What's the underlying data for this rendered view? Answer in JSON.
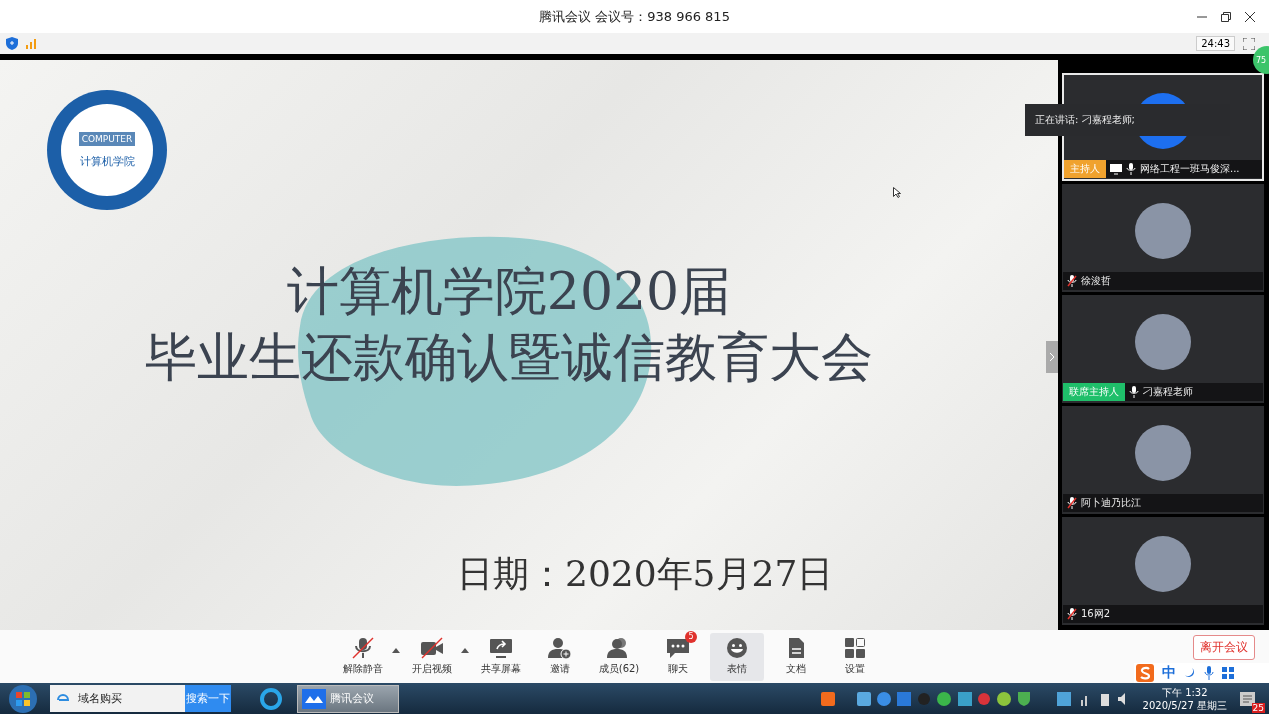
{
  "window": {
    "title": "腾讯会议 会议号：938 966 815"
  },
  "top_bar": {
    "timer": "24:43",
    "network_badge": "75"
  },
  "slide": {
    "logo_text": "COMPUTER",
    "logo_caption": "计算机学院",
    "title_lines": [
      "计算机学院2020届",
      "毕业生还款确认暨诚信教育大会"
    ],
    "date": "日期：2020年5月27日"
  },
  "speaking_tooltip": "正在讲话: 刁嘉程老师;",
  "participants": [
    {
      "name": "网络工程一班马俊深...",
      "role": "主持人",
      "color": "#f0a22e",
      "muted": false,
      "sharing": true,
      "selected": true,
      "kind": "logo"
    },
    {
      "name": "徐浚哲",
      "muted": true,
      "sharing": false,
      "selected": false,
      "kind": "photo"
    },
    {
      "name": "刁嘉程老师",
      "role": "联席主持人",
      "color": "#1fbf6a",
      "muted": false,
      "sharing": false,
      "selected": false,
      "kind": "photo"
    },
    {
      "name": "阿卜迪乃比江",
      "muted": true,
      "sharing": false,
      "selected": false,
      "kind": "photo"
    },
    {
      "name": "16网2",
      "muted": true,
      "sharing": false,
      "selected": false,
      "kind": "photo"
    }
  ],
  "toolbar": [
    {
      "label": "解除静音",
      "kind": "mic",
      "off": true,
      "caret": true,
      "selected": false
    },
    {
      "label": "开启视频",
      "kind": "camera",
      "off": true,
      "caret": true,
      "selected": false
    },
    {
      "label": "共享屏幕",
      "kind": "share",
      "selected": false
    },
    {
      "label": "邀请",
      "kind": "invite",
      "selected": false
    },
    {
      "label": "成员(62)",
      "kind": "members",
      "selected": false
    },
    {
      "label": "聊天",
      "kind": "chat",
      "badge": "5",
      "selected": false
    },
    {
      "label": "表情",
      "kind": "emoji",
      "selected": true
    },
    {
      "label": "文档",
      "kind": "doc",
      "selected": false
    },
    {
      "label": "设置",
      "kind": "settings",
      "selected": false
    }
  ],
  "leave_button": "离开会议",
  "ime_bar": {
    "mode": "中"
  },
  "taskbar": {
    "search_value": "域名购买",
    "search_button": "搜索一下",
    "task": "腾讯会议",
    "time": "下午 1:32",
    "date": "2020/5/27 星期三",
    "notification_count": "25"
  }
}
